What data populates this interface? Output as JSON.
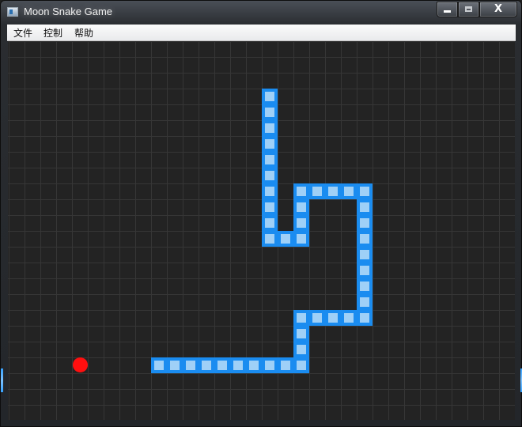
{
  "window": {
    "title": "Moon Snake Game",
    "close_glyph": "X"
  },
  "menu": {
    "file": "文件",
    "control": "控制",
    "help": "帮助"
  },
  "game": {
    "grid_columns": 32,
    "grid_rows": 24,
    "colors": {
      "background": "#232323",
      "grid_line": "#363636",
      "snake_outer": "#1a8cf0",
      "snake_inner": "#9fd0f7",
      "food": "#ff0f0f"
    },
    "snake_cells": [
      [
        16,
        3
      ],
      [
        16,
        4
      ],
      [
        16,
        5
      ],
      [
        16,
        6
      ],
      [
        16,
        7
      ],
      [
        16,
        8
      ],
      [
        16,
        9
      ],
      [
        16,
        10
      ],
      [
        16,
        11
      ],
      [
        16,
        12
      ],
      [
        17,
        12
      ],
      [
        18,
        12
      ],
      [
        18,
        11
      ],
      [
        18,
        10
      ],
      [
        18,
        9
      ],
      [
        19,
        9
      ],
      [
        20,
        9
      ],
      [
        21,
        9
      ],
      [
        22,
        9
      ],
      [
        22,
        10
      ],
      [
        22,
        11
      ],
      [
        22,
        12
      ],
      [
        22,
        13
      ],
      [
        22,
        14
      ],
      [
        22,
        15
      ],
      [
        22,
        16
      ],
      [
        22,
        17
      ],
      [
        21,
        17
      ],
      [
        20,
        17
      ],
      [
        19,
        17
      ],
      [
        18,
        17
      ],
      [
        18,
        18
      ],
      [
        18,
        19
      ],
      [
        18,
        20
      ],
      [
        17,
        20
      ],
      [
        16,
        20
      ],
      [
        15,
        20
      ],
      [
        14,
        20
      ],
      [
        13,
        20
      ],
      [
        12,
        20
      ],
      [
        11,
        20
      ],
      [
        10,
        20
      ],
      [
        9,
        20
      ]
    ],
    "food_cell": [
      4,
      20
    ]
  }
}
